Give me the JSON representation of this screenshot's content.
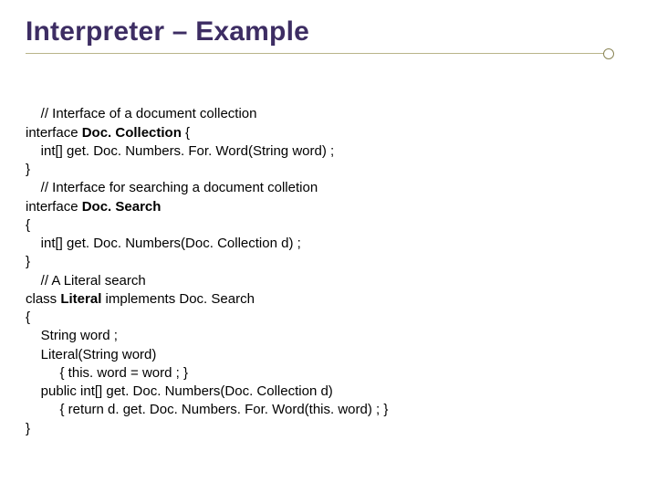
{
  "title": "Interpreter – Example",
  "code": {
    "c01": "    // Interface of a document collection",
    "c02a": "interface ",
    "c02b": "Doc. Collection",
    "c02c": " {",
    "c03": "    int[] get. Doc. Numbers. For. Word(String word) ;",
    "c04": "}",
    "c05": "    // Interface for searching a document colletion",
    "c06a": "interface ",
    "c06b": "Doc. Search",
    "c07": "{",
    "c08": "    int[] get. Doc. Numbers(Doc. Collection d) ;",
    "c09": "}",
    "c10": "    // A Literal search",
    "c11a": "class ",
    "c11b": "Literal",
    "c11c": " implements Doc. Search",
    "c12": "{",
    "c13": "    String word ;",
    "c14": "    Literal(String word)",
    "c15": "         { this. word = word ; }",
    "c16": "    public int[] get. Doc. Numbers(Doc. Collection d)",
    "c17": "         { return d. get. Doc. Numbers. For. Word(this. word) ; }",
    "c18": "}"
  }
}
